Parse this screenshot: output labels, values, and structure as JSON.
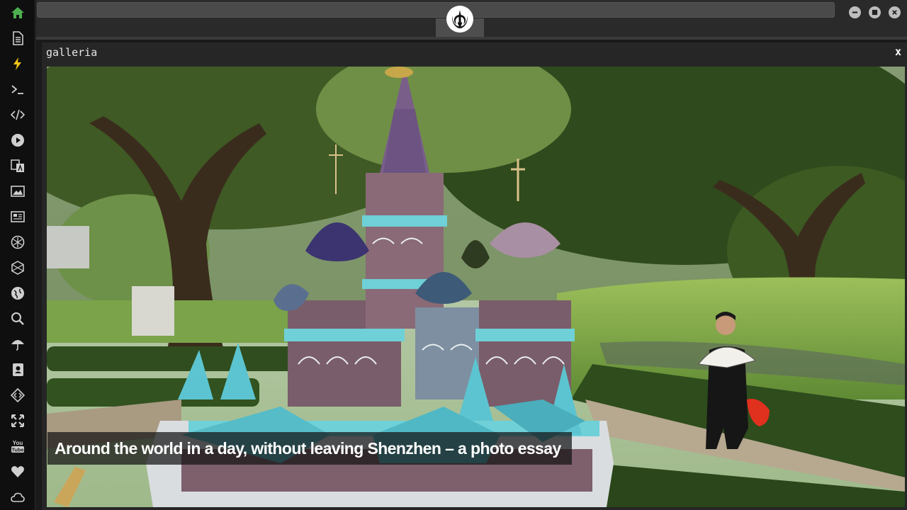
{
  "window": {
    "title": "galleria",
    "close_label": "x"
  },
  "caption": "Around the world in a day, without leaving Shenzhen – a photo essay",
  "sidebar": {
    "icons": [
      "home-icon",
      "document-icon",
      "lightning-icon",
      "terminal-icon",
      "code-icon",
      "play-icon",
      "translate-icon",
      "image-icon",
      "news-icon",
      "aperture-icon",
      "hexagon-icon",
      "globe-icon",
      "search-icon",
      "umbrella-icon",
      "contact-icon",
      "dev-icon",
      "expand-icon",
      "youtube-icon",
      "heart-icon",
      "cloud-icon"
    ],
    "youtube_text": "You Tube"
  },
  "colors": {
    "active_icon": "#4caf50",
    "icon": "#cfcfcf",
    "accent_lightning": "#f5c518"
  },
  "image": {
    "subject": "miniature St. Basil's Cathedral in park",
    "logo": "rebel-alliance-logo"
  }
}
